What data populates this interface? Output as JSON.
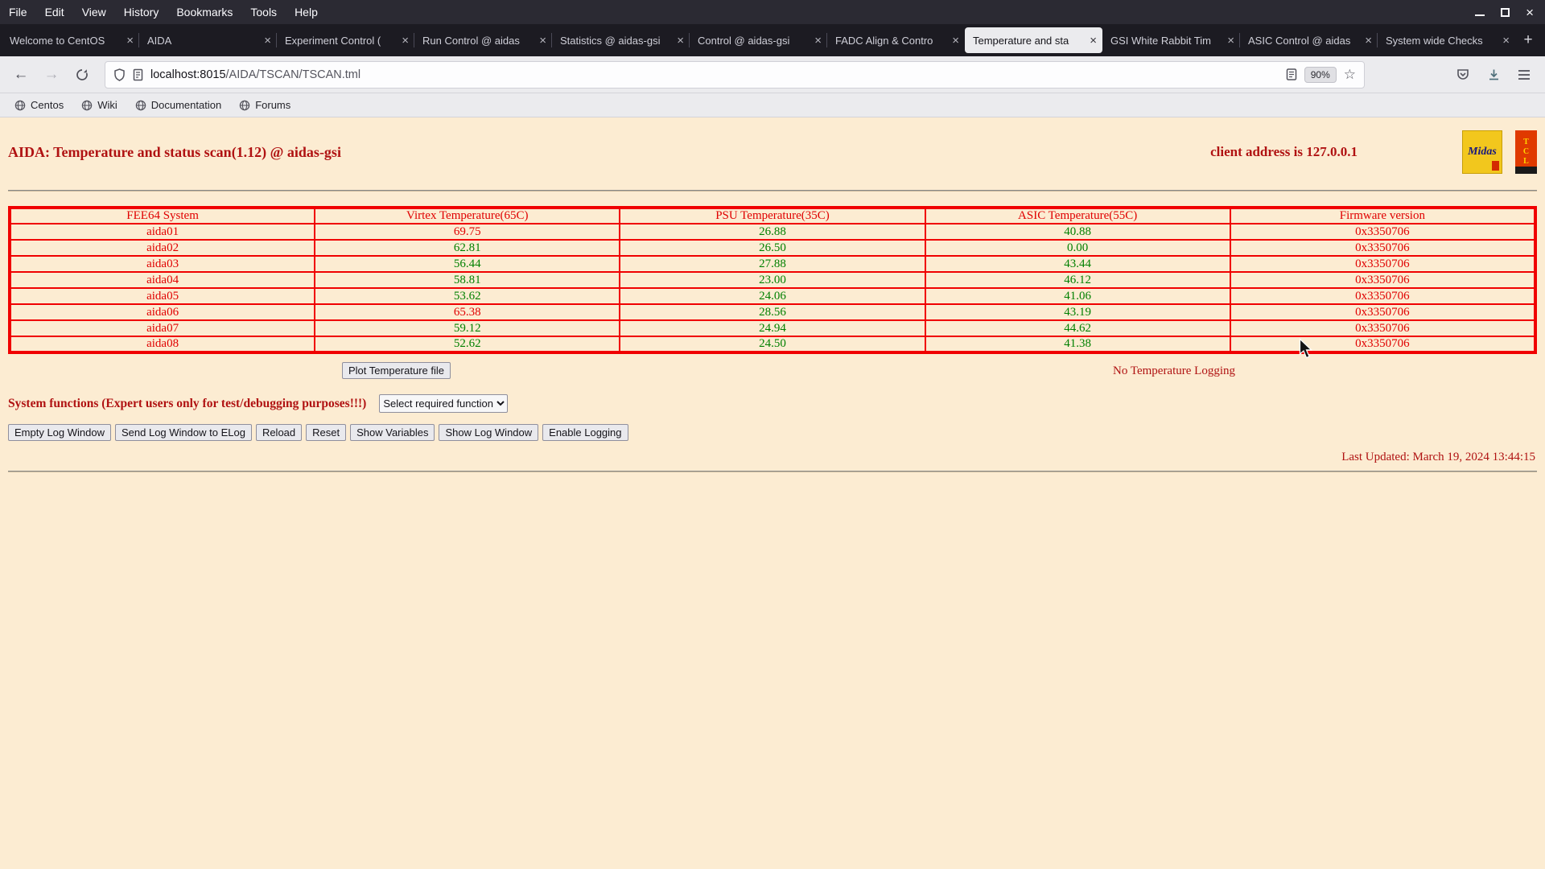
{
  "icons": {
    "close": "×",
    "new_tab": "+",
    "back": "←",
    "forward": "→",
    "star": "☆"
  },
  "browser": {
    "menu": [
      "File",
      "Edit",
      "View",
      "History",
      "Bookmarks",
      "Tools",
      "Help"
    ],
    "tabs": [
      "Welcome to CentOS",
      "AIDA",
      "Experiment Control (",
      "Run Control @ aidas",
      "Statistics @ aidas-gsi",
      "Control @ aidas-gsi",
      "FADC Align & Contro",
      "Temperature and sta",
      "GSI White Rabbit Tim",
      "ASIC Control @ aidas",
      "System wide Checks"
    ],
    "nav": {
      "url_domain": "localhost:8015",
      "url_path": "/AIDA/TSCAN/TSCAN.tml",
      "zoom": "90%"
    },
    "bookmarks": [
      "Centos",
      "Wiki",
      "Documentation",
      "Forums"
    ]
  },
  "page": {
    "title": "AIDA: Temperature and status scan(1.12) @ aidas-gsi",
    "client_address": "client address is 127.0.0.1",
    "logos": {
      "midas": "Midas",
      "tcl": "TCL"
    },
    "table": {
      "headers": [
        "FEE64 System",
        "Virtex Temperature(65C)",
        "PSU Temperature(35C)",
        "ASIC Temperature(55C)",
        "Firmware version"
      ],
      "rows": [
        {
          "system": "aida01",
          "virtex": "69.75",
          "virtex_alarm": true,
          "psu": "26.88",
          "asic": "40.88",
          "firmware": "0x3350706"
        },
        {
          "system": "aida02",
          "virtex": "62.81",
          "virtex_alarm": false,
          "psu": "26.50",
          "asic": "0.00",
          "firmware": "0x3350706"
        },
        {
          "system": "aida03",
          "virtex": "56.44",
          "virtex_alarm": false,
          "psu": "27.88",
          "asic": "43.44",
          "firmware": "0x3350706"
        },
        {
          "system": "aida04",
          "virtex": "58.81",
          "virtex_alarm": false,
          "psu": "23.00",
          "asic": "46.12",
          "firmware": "0x3350706"
        },
        {
          "system": "aida05",
          "virtex": "53.62",
          "virtex_alarm": false,
          "psu": "24.06",
          "asic": "41.06",
          "firmware": "0x3350706"
        },
        {
          "system": "aida06",
          "virtex": "65.38",
          "virtex_alarm": true,
          "psu": "28.56",
          "asic": "43.19",
          "firmware": "0x3350706"
        },
        {
          "system": "aida07",
          "virtex": "59.12",
          "virtex_alarm": false,
          "psu": "24.94",
          "asic": "44.62",
          "firmware": "0x3350706"
        },
        {
          "system": "aida08",
          "virtex": "52.62",
          "virtex_alarm": false,
          "psu": "24.50",
          "asic": "41.38",
          "firmware": "0x3350706"
        }
      ]
    },
    "plot_button_label": "Plot Temperature file",
    "logging_status": "No Temperature Logging",
    "system_functions": {
      "label": "System functions (Expert users only for test/debugging purposes!!!)",
      "select_value": "Select required function"
    },
    "action_buttons": [
      "Empty Log Window",
      "Send Log Window to ELog",
      "Reload",
      "Reset",
      "Show Variables",
      "Show Log Window",
      "Enable Logging"
    ],
    "last_updated": "Last Updated: March 19, 2024 13:44:15"
  },
  "colors": {
    "alarm": "#e00000",
    "ok": "#008000",
    "accent_red": "#b01212",
    "table_border": "#f00000"
  }
}
